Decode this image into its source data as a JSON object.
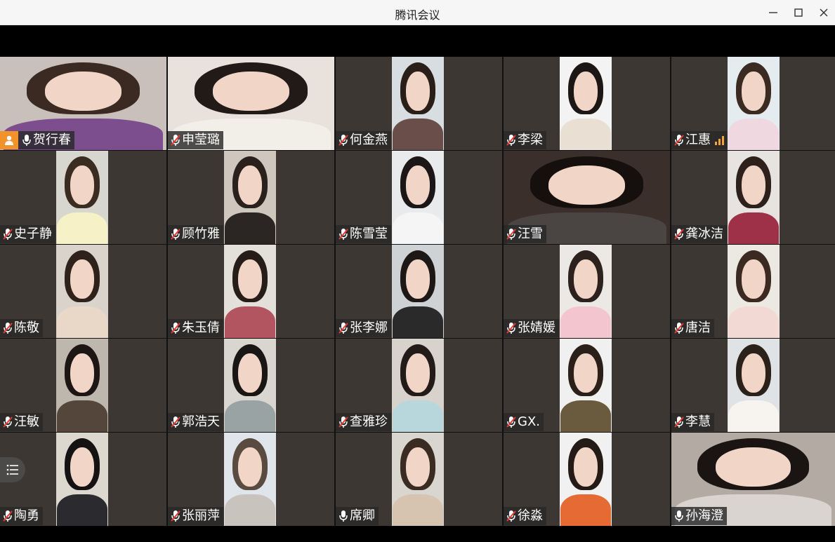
{
  "window": {
    "title": "腾讯会议"
  },
  "participants": [
    {
      "name": "贺行春",
      "mic": "on",
      "host": true,
      "active": true,
      "bg": "#c9c0bb",
      "hair": "#3a2a22",
      "body": "#7c4e8e",
      "full": true
    },
    {
      "name": "申莹璐",
      "mic": "muted",
      "bg": "#e9e2dc",
      "hair": "#221a17",
      "body": "#f2efe9",
      "full": true
    },
    {
      "name": "何金燕",
      "mic": "muted",
      "bg": "#d8dde2",
      "hair": "#2a1e18",
      "body": "#6a4e4a"
    },
    {
      "name": "李梁",
      "mic": "muted",
      "bg": "#f3f3f3",
      "hair": "#1c1614",
      "body": "#e9dfd2"
    },
    {
      "name": "江惠",
      "mic": "muted",
      "signal": true,
      "bg": "#e4ecef",
      "hair": "#3a2a22",
      "body": "#efd8e0"
    },
    {
      "name": "史子静",
      "mic": "muted",
      "bg": "#d7d6cf",
      "hair": "#3b2c22",
      "body": "#f6f1c6"
    },
    {
      "name": "顾竹雅",
      "mic": "muted",
      "bg": "#cfc7bd",
      "hair": "#2a211c",
      "body": "#2b2623"
    },
    {
      "name": "陈雪莹",
      "mic": "muted",
      "bg": "#e8eaec",
      "hair": "#1c1716",
      "body": "#f5f5f5"
    },
    {
      "name": "汪雪",
      "mic": "muted",
      "bg": "#3a2f2a",
      "hair": "#15100e",
      "body": "#4a4442",
      "full": true
    },
    {
      "name": "龚冰洁",
      "mic": "muted",
      "bg": "#e6e3e1",
      "hair": "#2e211c",
      "body": "#9e3047"
    },
    {
      "name": "陈敬",
      "mic": "muted",
      "bg": "#dad3cc",
      "hair": "#2f221b",
      "body": "#e9d8c8"
    },
    {
      "name": "朱玉倩",
      "mic": "muted",
      "bg": "#e3e0da",
      "hair": "#261c18",
      "body": "#b35461"
    },
    {
      "name": "张李娜",
      "mic": "muted",
      "bg": "#cfd2d4",
      "hair": "#1d1716",
      "body": "#2a2a2a"
    },
    {
      "name": "张婧媛",
      "mic": "muted",
      "bg": "#ebe8e6",
      "hair": "#2c211c",
      "body": "#f3c5cf"
    },
    {
      "name": "唐洁",
      "mic": "muted",
      "bg": "#ece9e3",
      "hair": "#3a2a22",
      "body": "#f2d9d4"
    },
    {
      "name": "汪敏",
      "mic": "muted",
      "bg": "#bdb7ad",
      "hair": "#1c1614",
      "body": "#55463c"
    },
    {
      "name": "郭浩天",
      "mic": "muted",
      "bg": "#d9d5cf",
      "hair": "#1a1614",
      "body": "#9aa3a3"
    },
    {
      "name": "查雅珍",
      "mic": "muted",
      "bg": "#d7d2cc",
      "hair": "#231b17",
      "body": "#b7d7dc"
    },
    {
      "name": "GX.",
      "mic": "muted",
      "bg": "#f0f0f0",
      "hair": "#2a1f19",
      "body": "#6a5a3e"
    },
    {
      "name": "李慧",
      "mic": "muted",
      "bg": "#dfe3e5",
      "hair": "#2b211b",
      "body": "#f7f4ef"
    },
    {
      "name": "陶勇",
      "mic": "muted",
      "bg": "#dcd7cf",
      "hair": "#141212",
      "body": "#2a2a2f"
    },
    {
      "name": "张丽萍",
      "mic": "muted",
      "bg": "#dfe5ea",
      "hair": "#5a4b40",
      "body": "#c9c3bd"
    },
    {
      "name": "席卿",
      "mic": "on",
      "bg": "#d9d6d0",
      "hair": "#3a2c22",
      "body": "#d6c4b1"
    },
    {
      "name": "徐淼",
      "mic": "muted",
      "bg": "#f1f1f1",
      "hair": "#241b17",
      "body": "#e56a33"
    },
    {
      "name": "孙海澄",
      "mic": "on",
      "bg": "#b3aba3",
      "hair": "#1a1512",
      "body": "#d9d4cf",
      "full": true
    }
  ]
}
